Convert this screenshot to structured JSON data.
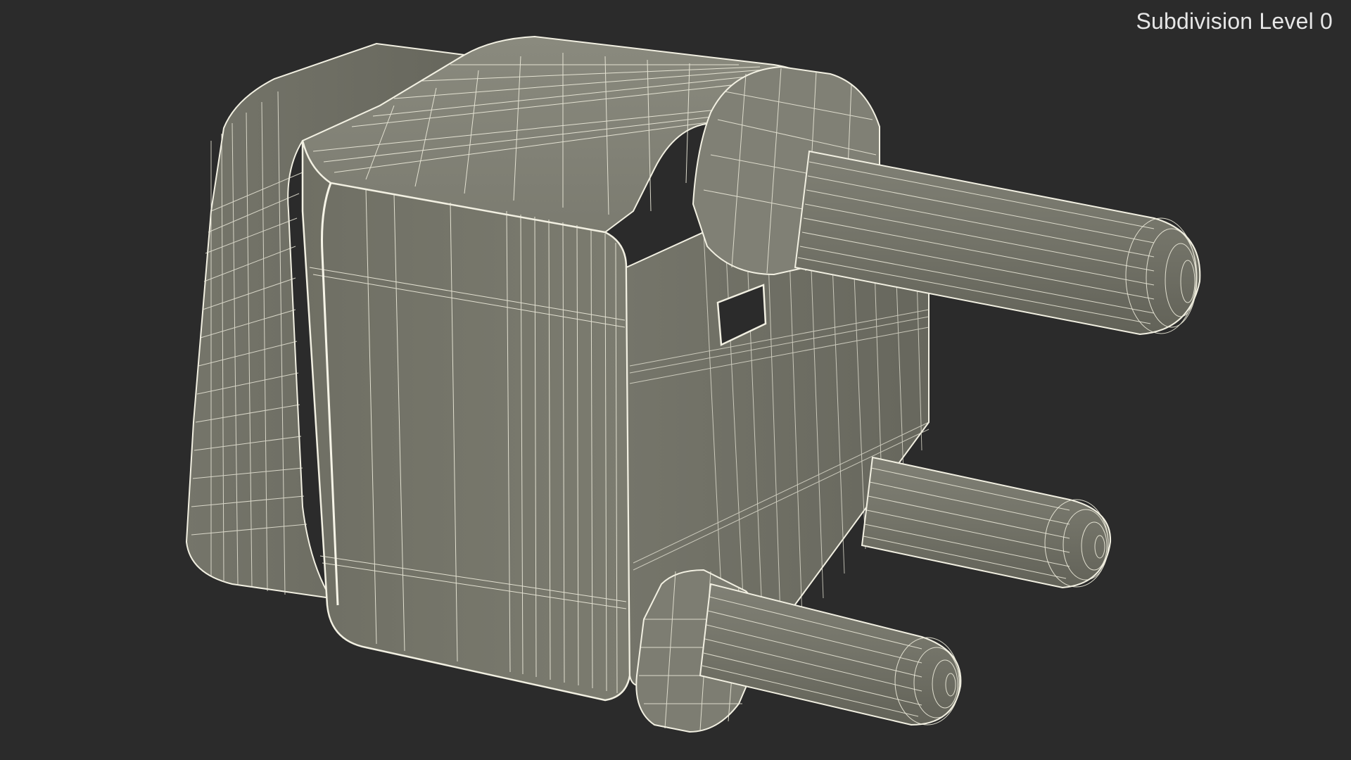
{
  "viewport": {
    "background_color": "#2b2b2b",
    "label": "Subdivision Level 0",
    "label_color": "#e6e6e6"
  },
  "model": {
    "subject": "three-pin electrical plug wireframe",
    "surface_color": "#7b7b6f",
    "wire_color": "#f2f0e2"
  }
}
